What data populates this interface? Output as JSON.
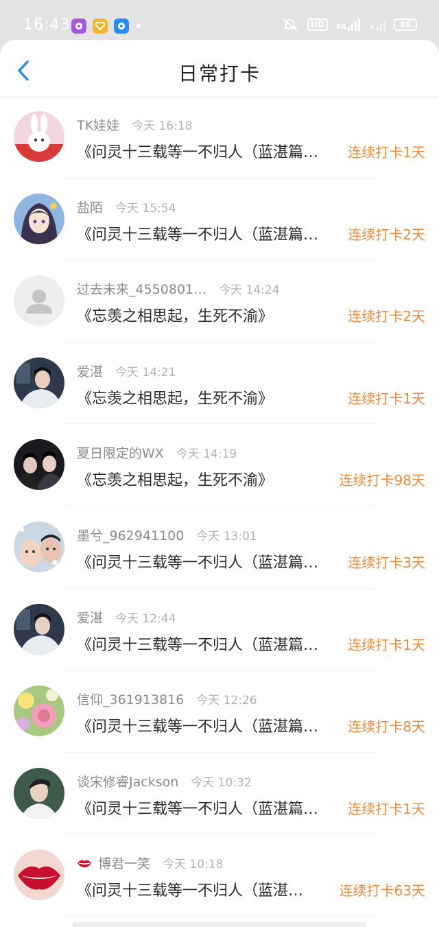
{
  "status_bar": {
    "time": "16:43",
    "network": "4G",
    "hd": "HD",
    "battery": "86"
  },
  "header": {
    "title": "日常打卡",
    "accent_color": "#2b8be6"
  },
  "colors": {
    "streak": "#f0883a",
    "username": "#8a8a8a",
    "time": "#b2b2b2"
  },
  "checkins": [
    {
      "username": "TK娃娃",
      "time": "今天 16:18",
      "message": "《问灵十三载等一不归人（蓝湛篇…",
      "streak": "连续打卡1天",
      "avatar": "bunny-avatar"
    },
    {
      "username": "盐陌",
      "time": "今天 15:54",
      "message": "《问灵十三载等一不归人（蓝湛篇…",
      "streak": "连续打卡2天",
      "avatar": "anime-girl-avatar"
    },
    {
      "username": "过去未来_4550801…",
      "time": "今天 14:24",
      "message": "《忘羡之相思起，生死不渝》",
      "streak": "连续打卡2天",
      "avatar": "default-user-avatar"
    },
    {
      "username": "爱湛",
      "time": "今天 14:21",
      "message": "《忘羡之相思起，生死不渝》",
      "streak": "连续打卡1天",
      "avatar": "costume-avatar"
    },
    {
      "username": "夏日限定的WX",
      "time": "今天 14:19",
      "message": "《忘羡之相思起，生死不渝》",
      "streak": "连续打卡98天",
      "avatar": "duo-avatar"
    },
    {
      "username": "墨兮_962941100",
      "time": "今天 13:01",
      "message": "《问灵十三载等一不归人（蓝湛篇…",
      "streak": "连续打卡3天",
      "avatar": "kids-avatar"
    },
    {
      "username": "爱湛",
      "time": "今天 12:44",
      "message": "《问灵十三载等一不归人（蓝湛篇…",
      "streak": "连续打卡1天",
      "avatar": "costume-avatar"
    },
    {
      "username": "信仰_361913816",
      "time": "今天 12:26",
      "message": "《问灵十三载等一不归人（蓝湛篇…",
      "streak": "连续打卡8天",
      "avatar": "flowers-avatar"
    },
    {
      "username": "谈宋修睿Jackson",
      "time": "今天 10:32",
      "message": "《问灵十三载等一不归人（蓝湛篇…",
      "streak": "连续打卡1天",
      "avatar": "portrait-avatar"
    },
    {
      "username": "博君一笑",
      "time": "今天 10:18",
      "message": "《问灵十三载等一不归人（蓝湛…",
      "streak": "连续打卡63天",
      "avatar": "lips-avatar",
      "badge": "lips-badge-icon"
    }
  ]
}
